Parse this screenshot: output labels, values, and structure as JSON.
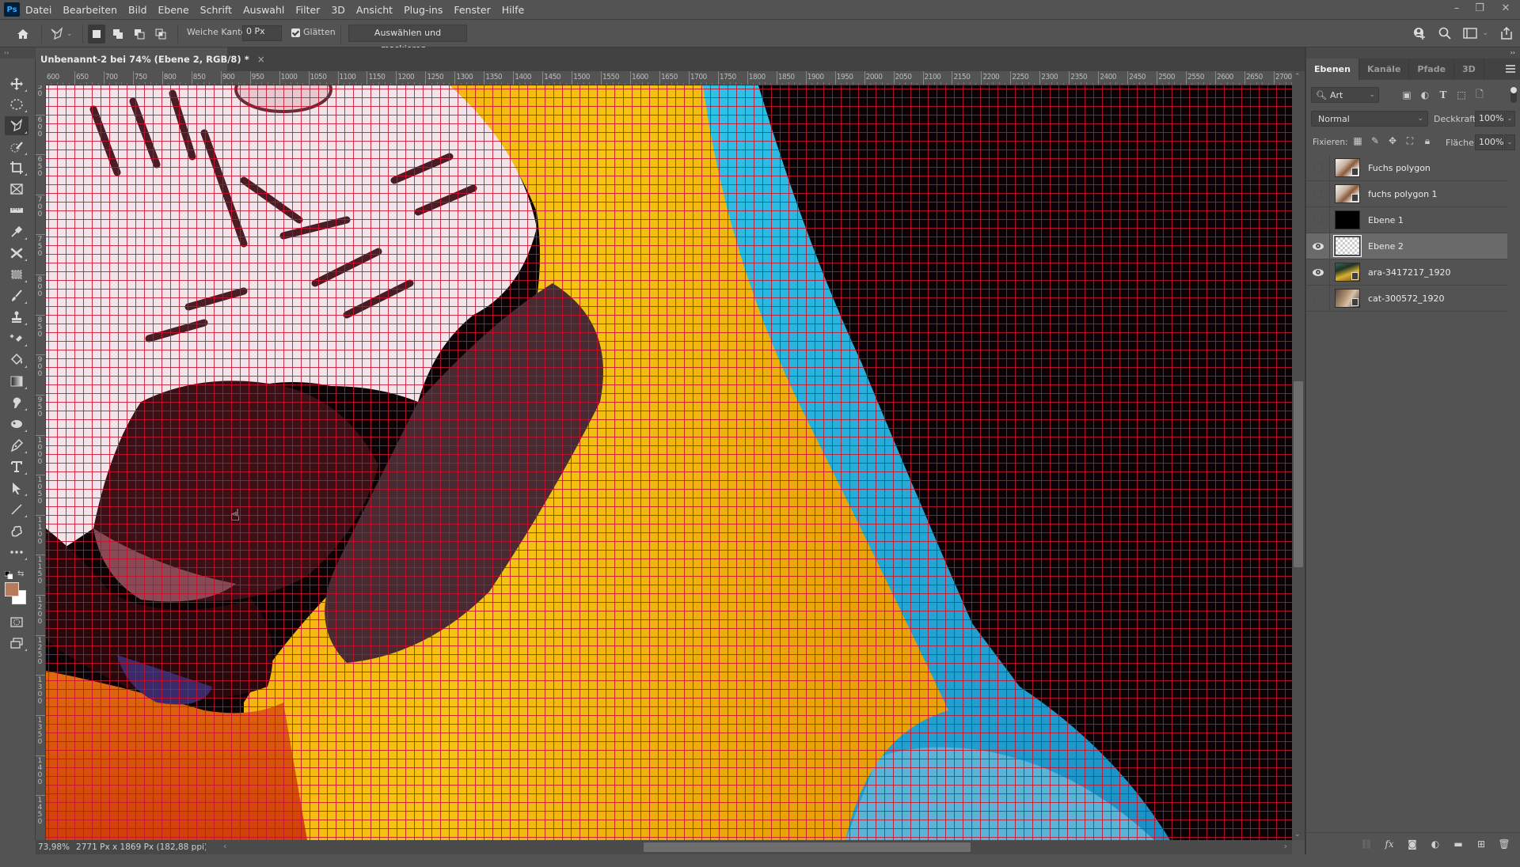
{
  "app": {
    "logo": "Ps",
    "menu": [
      "Datei",
      "Bearbeiten",
      "Bild",
      "Ebene",
      "Schrift",
      "Auswahl",
      "Filter",
      "3D",
      "Ansicht",
      "Plug-ins",
      "Fenster",
      "Hilfe"
    ],
    "window_controls": {
      "minimize": "–",
      "restore": "❐",
      "close": "✕"
    }
  },
  "options_bar": {
    "tool_icon": "polygon-lasso-icon",
    "feather_label": "Weiche Kante:",
    "feather_value": "0 Px",
    "smooth_label": "Glätten",
    "smooth_checked": true,
    "select_mask_label": "Auswählen und maskieren..."
  },
  "document": {
    "tab_title": "Unbenannt-2 bei 74% (Ebene 2, RGB/8) *",
    "close_glyph": "×"
  },
  "rulers": {
    "top_labels": [
      "600",
      "650",
      "700",
      "750",
      "800",
      "850",
      "900",
      "950",
      "1000",
      "1050",
      "1100",
      "1150",
      "1200",
      "1250",
      "1300",
      "1350",
      "1400",
      "1450",
      "1500",
      "1550",
      "1600",
      "1650",
      "1700",
      "1750",
      "1800",
      "1850",
      "1900",
      "1950",
      "2000",
      "2050",
      "2100",
      "2150",
      "2200",
      "2250",
      "2300",
      "2350",
      "2400",
      "2450",
      "2500",
      "2550",
      "2600",
      "2650",
      "2700"
    ],
    "left_labels": [
      "550",
      "600",
      "650",
      "700",
      "750",
      "800",
      "850",
      "900",
      "950",
      "1000",
      "1050",
      "1100",
      "1150",
      "1200",
      "1250",
      "1300",
      "1350",
      "1400",
      "1450"
    ]
  },
  "status": {
    "zoom": "73,98%",
    "doc_info": "2771 Px x 1869 Px (182,88 ppi)",
    "arrow": "›"
  },
  "scroll": {
    "vertical_position": 0.4,
    "vertical_visible": 0.25,
    "horizontal_position": 0.4,
    "horizontal_visible": 0.31
  },
  "colors": {
    "foreground": "#b97a5c",
    "background": "#ffffff",
    "grid": "#c8102e"
  },
  "panel": {
    "tabs": [
      {
        "label": "Ebenen",
        "active": true
      },
      {
        "label": "Kanäle",
        "active": false
      },
      {
        "label": "Pfade",
        "active": false
      },
      {
        "label": "3D",
        "active": false
      }
    ],
    "filter_label": "Art",
    "blend_mode": "Normal",
    "opacity_label": "Deckkraft:",
    "opacity_value": "100%",
    "lock_label": "Fixieren:",
    "fill_label": "Fläche:",
    "fill_value": "100%",
    "layers": [
      {
        "name": "Fuchs polygon",
        "visible": false,
        "selected": false,
        "thumb": "fox",
        "smart_object": true
      },
      {
        "name": "fuchs polygon 1",
        "visible": false,
        "selected": false,
        "thumb": "fox",
        "smart_object": true
      },
      {
        "name": "Ebene 1",
        "visible": false,
        "selected": false,
        "thumb": "black",
        "smart_object": false
      },
      {
        "name": "Ebene 2",
        "visible": true,
        "selected": true,
        "thumb": "transparent",
        "smart_object": false
      },
      {
        "name": "ara-3417217_1920",
        "visible": true,
        "selected": false,
        "thumb": "ara",
        "smart_object": true
      },
      {
        "name": "cat-300572_1920",
        "visible": false,
        "selected": false,
        "thumb": "cat",
        "smart_object": true
      }
    ]
  }
}
